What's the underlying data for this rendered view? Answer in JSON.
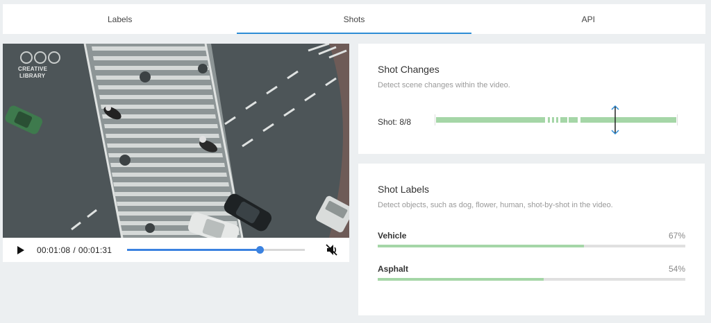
{
  "tabs": [
    {
      "label": "Labels",
      "active": false
    },
    {
      "label": "Shots",
      "active": true
    },
    {
      "label": "API",
      "active": false
    }
  ],
  "video": {
    "watermark_lines": [
      "CREATIVE",
      "LIBRARY"
    ],
    "current_time": "00:01:08",
    "duration": "00:01:31",
    "time_separator": "/",
    "progress_percent": 74.7,
    "muted": true,
    "icons": [
      "play-icon",
      "muted-speaker-icon"
    ]
  },
  "shot_changes": {
    "title": "Shot Changes",
    "subtitle": "Detect scene changes within the video.",
    "shot_label": "Shot: 8/8",
    "segments": [
      {
        "start": 0.0,
        "end": 0.455
      },
      {
        "start": 0.464,
        "end": 0.475
      },
      {
        "start": 0.482,
        "end": 0.492
      },
      {
        "start": 0.5,
        "end": 0.51
      },
      {
        "start": 0.518,
        "end": 0.545
      },
      {
        "start": 0.553,
        "end": 0.59
      },
      {
        "start": 0.6,
        "end": 1.0
      }
    ],
    "playhead_fraction": 0.746,
    "colors": {
      "segment": "#a5d6a7",
      "playhead": "#2d8cd5"
    }
  },
  "shot_labels": {
    "title": "Shot Labels",
    "subtitle": "Detect objects, such as dog, flower, human, shot-by-shot in the video.",
    "items": [
      {
        "name": "Vehicle",
        "percent_label": "67%",
        "value": 67
      },
      {
        "name": "Asphalt",
        "percent_label": "54%",
        "value": 54
      }
    ]
  }
}
